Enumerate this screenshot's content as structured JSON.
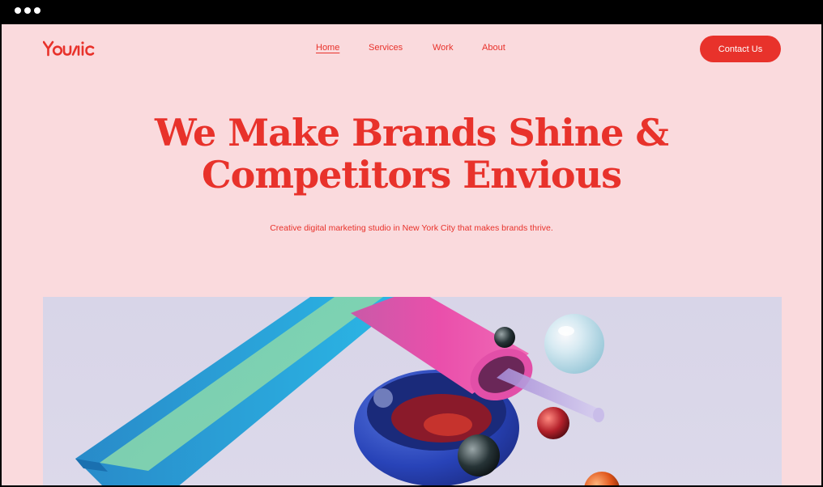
{
  "brand": {
    "logo_text": "Younic",
    "accent": "#e8322b",
    "background": "#fadadd"
  },
  "nav": {
    "items": [
      {
        "label": "Home",
        "active": true
      },
      {
        "label": "Services",
        "active": false
      },
      {
        "label": "Work",
        "active": false
      },
      {
        "label": "About",
        "active": false
      }
    ],
    "cta_label": "Contact Us"
  },
  "hero": {
    "title_line1": "We Make Brands Shine &",
    "title_line2": "Competitors Envious",
    "subtitle": "Creative digital marketing studio in New York City that makes brands thrive."
  },
  "icons": {
    "window_controls": "three-dots"
  }
}
